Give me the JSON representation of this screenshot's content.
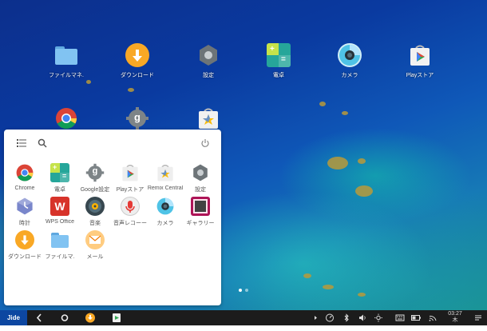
{
  "desktop": {
    "icons": [
      {
        "label": "ファイルマネ.",
        "icon": "folder-icon"
      },
      {
        "label": "ダウンロード",
        "icon": "download-icon"
      },
      {
        "label": "設定",
        "icon": "settings-icon"
      },
      {
        "label": "電卓",
        "icon": "calculator-icon"
      },
      {
        "label": "カメラ",
        "icon": "camera-icon"
      },
      {
        "label": "Playストア",
        "icon": "play-store-icon"
      }
    ],
    "row2_icons": [
      "chrome-icon",
      "google-settings-icon",
      "play-store-icon"
    ],
    "google_g": "g"
  },
  "drawer": {
    "apps": [
      {
        "label": "Chrome",
        "icon": "chrome-icon"
      },
      {
        "label": "電卓",
        "icon": "calculator-icon"
      },
      {
        "label": "Google設定",
        "icon": "google-settings-icon"
      },
      {
        "label": "Playストア",
        "icon": "play-store-icon"
      },
      {
        "label": "Remix Central",
        "icon": "remix-central-icon"
      },
      {
        "label": "設定",
        "icon": "settings-icon"
      },
      {
        "label": "時計",
        "icon": "clock-icon"
      },
      {
        "label": "WPS Office",
        "icon": "wps-office-icon"
      },
      {
        "label": "音楽",
        "icon": "music-icon"
      },
      {
        "label": "音声レコーー",
        "icon": "voice-recorder-icon"
      },
      {
        "label": "カメラ",
        "icon": "camera-icon"
      },
      {
        "label": "ギャラリー",
        "icon": "gallery-icon"
      },
      {
        "label": "ダウンロード",
        "icon": "download-icon"
      },
      {
        "label": "ファイルマ.",
        "icon": "folder-icon"
      },
      {
        "label": "メール",
        "icon": "mail-icon"
      }
    ],
    "wps_letter": "W",
    "google_g": "g"
  },
  "taskbar": {
    "clock_time": "03:27",
    "clock_day": "木",
    "logo": "Jide",
    "colors": {
      "bg": "#1c1c1c"
    }
  },
  "colors": {
    "download": "#f9a825",
    "folder": "#81c3f2",
    "settings": "#6d7478",
    "calculator": "#26a69a",
    "wps": "#d7332a"
  }
}
